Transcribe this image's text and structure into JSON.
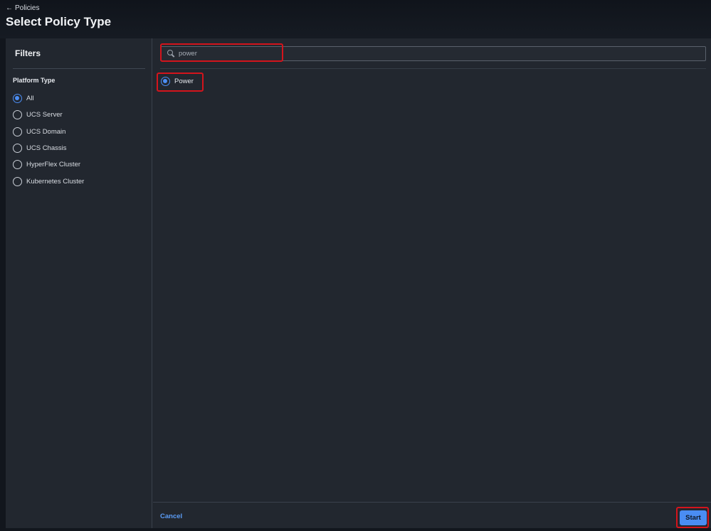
{
  "header": {
    "back_label": "Policies",
    "title": "Select Policy Type"
  },
  "sidebar": {
    "title": "Filters",
    "group_label": "Platform Type",
    "options": [
      {
        "label": "All",
        "checked": true
      },
      {
        "label": "UCS Server",
        "checked": false
      },
      {
        "label": "UCS Domain",
        "checked": false
      },
      {
        "label": "UCS Chassis",
        "checked": false
      },
      {
        "label": "HyperFlex Cluster",
        "checked": false
      },
      {
        "label": "Kubernetes Cluster",
        "checked": false
      }
    ]
  },
  "search": {
    "value": "power",
    "placeholder": "Search"
  },
  "results": [
    {
      "label": "Power",
      "checked": true
    }
  ],
  "footer": {
    "cancel_label": "Cancel",
    "start_label": "Start"
  },
  "colors": {
    "accent": "#4a8df3",
    "highlight": "#d4141c"
  }
}
